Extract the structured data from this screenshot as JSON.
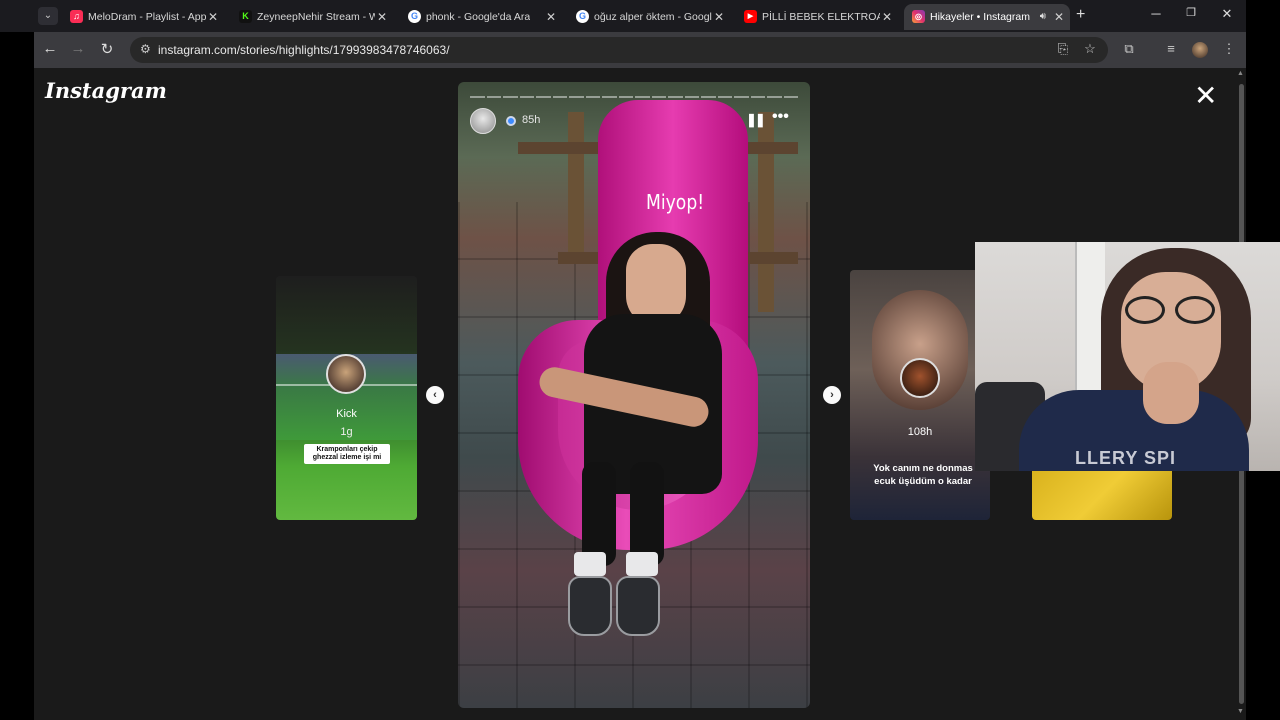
{
  "browser": {
    "tabs": [
      {
        "title": "MeloDram - Playlist - Appl",
        "favicon": "music-icon",
        "color": "#fa2d55",
        "active": false
      },
      {
        "title": "ZeyneepNehir Stream - W",
        "favicon": "kick-icon",
        "color": "#53fc18",
        "active": false
      },
      {
        "title": "phonk - Google'da Ara",
        "favicon": "google-icon",
        "color": "#ffffff",
        "active": false
      },
      {
        "title": "oğuz alper öktem - Google",
        "favicon": "google-icon",
        "color": "#ffffff",
        "active": false
      },
      {
        "title": "PİLLİ BEBEK ELEKTROAKUS",
        "favicon": "youtube-icon",
        "color": "#ff0000",
        "active": false
      },
      {
        "title": "Hikayeler • Instagram",
        "favicon": "instagram-icon",
        "color": "#e1306c",
        "active": true
      }
    ],
    "url": "instagram.com/stories/highlights/17993983478746063/"
  },
  "instagram": {
    "logo_text": "Instagram",
    "story": {
      "time_ago": "85h",
      "caption": "Miyop!",
      "segments": 20
    },
    "prev_story": {
      "name": "Kick",
      "time_ago": "1g",
      "sticker_text": "Kramponları çekip ghezzal izleme işi mi"
    },
    "next_story": {
      "time_ago": "108h",
      "text_line1": "Yok canım ne donmas",
      "text_line2": "ecuk üşüdüm o kadar"
    }
  },
  "webcam": {
    "shirt_text": "LLERY SPI"
  }
}
